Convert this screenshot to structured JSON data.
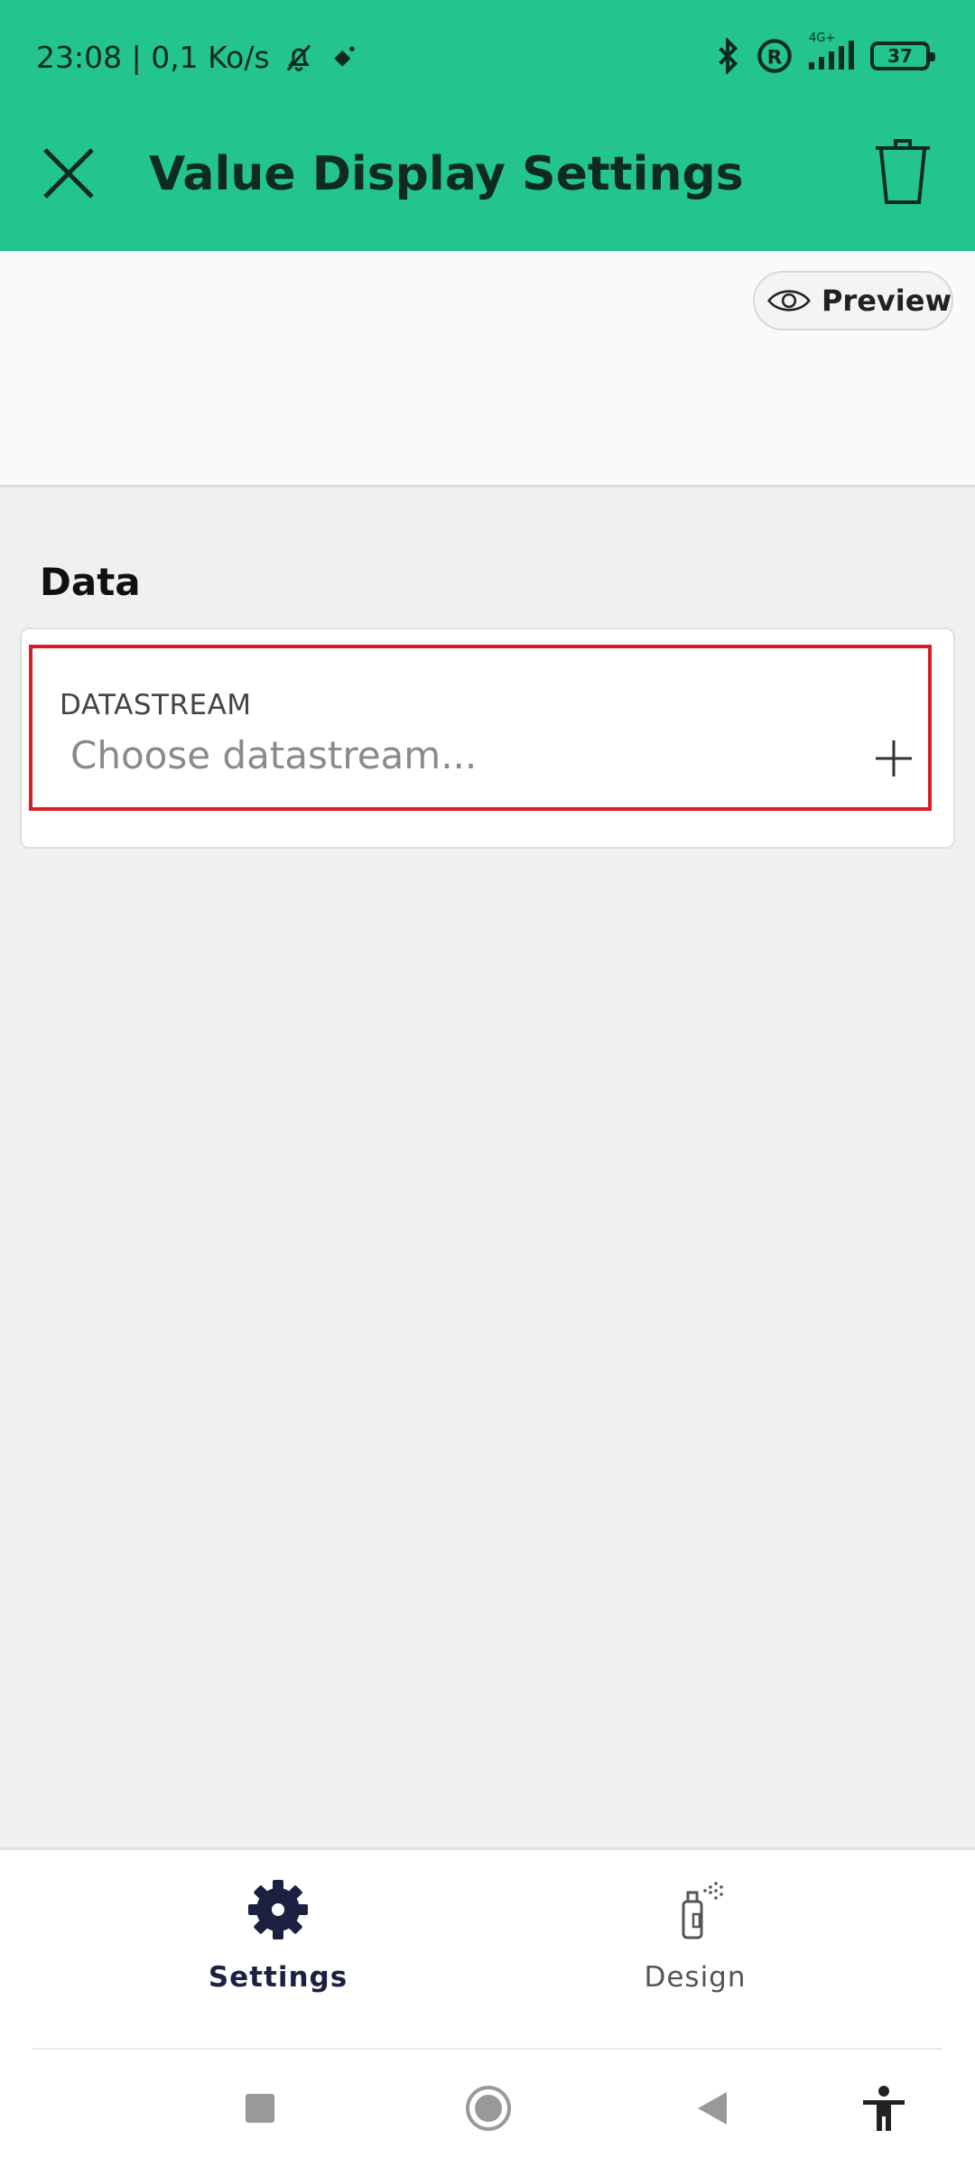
{
  "status_bar": {
    "time_and_speed": "23:08 | 0,1 Ko/s",
    "network": "4G+",
    "battery": "37"
  },
  "header": {
    "title": "Value Display Settings"
  },
  "preview": {
    "label": "Preview"
  },
  "data_section": {
    "title": "Data",
    "field_label": "DATASTREAM",
    "field_placeholder": "Choose datastream..."
  },
  "bottom_nav": {
    "items": [
      {
        "label": "Settings",
        "icon": "gear-icon",
        "active": true
      },
      {
        "label": "Design",
        "icon": "spray-paint-icon",
        "active": false
      }
    ]
  },
  "colors": {
    "header_bg": "#23c48e",
    "highlight_border": "#d91d25",
    "active_nav": "#1c2041"
  }
}
